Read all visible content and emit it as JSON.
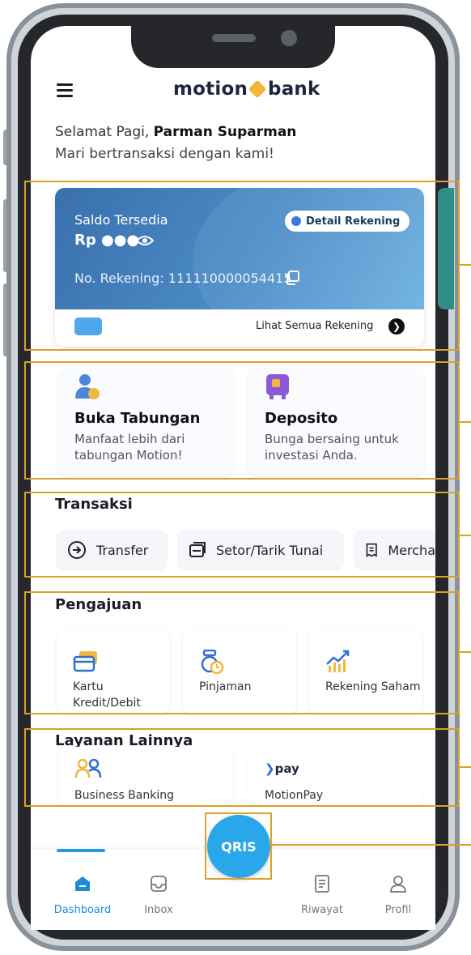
{
  "app": {
    "logo_left": "motion",
    "logo_right": "bank"
  },
  "greeting": {
    "salutation": "Selamat Pagi,",
    "name": "Parman Suparman",
    "subtitle": "Mari bertransaksi dengan kami!"
  },
  "account_card": {
    "balance_label": "Saldo Tersedia",
    "balance_value": "Rp ●●●",
    "detail_button": "Detail Rekening",
    "account_number": "No. Rekening: 111110000054415",
    "see_all": "Lihat Semua Rekening"
  },
  "promos": [
    {
      "title": "Buka Tabungan",
      "desc": "Manfaat lebih dari tabungan Motion!",
      "icon": "person-coin-icon"
    },
    {
      "title": "Deposito",
      "desc": "Bunga bersaing untuk investasi Anda.",
      "icon": "safe-icon"
    }
  ],
  "transaksi": {
    "title": "Transaksi",
    "items": [
      {
        "label": "Transfer",
        "icon": "transfer-icon"
      },
      {
        "label": "Setor/Tarik Tunai",
        "icon": "cash-icon"
      },
      {
        "label": "Mercha",
        "icon": "receipt-icon"
      }
    ]
  },
  "pengajuan": {
    "title": "Pengajuan",
    "items": [
      {
        "label": "Kartu Kredit/Debit",
        "icon": "card-icon"
      },
      {
        "label": "Pinjaman",
        "icon": "loan-icon"
      },
      {
        "label": "Rekening Saham",
        "icon": "stock-chart-icon"
      }
    ]
  },
  "layanan": {
    "title": "Layanan Lainnya",
    "items": [
      {
        "label": "Business Banking",
        "icon": "people-icon"
      },
      {
        "label": "MotionPay",
        "icon": "motionpay-logo",
        "logo_text": "pay"
      }
    ]
  },
  "qris_label": "QRIS",
  "bottom_nav": [
    {
      "label": "Dashboard",
      "icon": "home-icon",
      "active": true
    },
    {
      "label": "Inbox",
      "icon": "inbox-icon",
      "active": false
    },
    {
      "label": "Riwayat",
      "icon": "history-icon",
      "active": false
    },
    {
      "label": "Profil",
      "icon": "profile-icon",
      "active": false
    }
  ],
  "colors": {
    "primary": "#2596e8",
    "highlight": "#d9a22a",
    "brand_gold": "#f2b63a",
    "card_blue": "#3a6fae"
  }
}
